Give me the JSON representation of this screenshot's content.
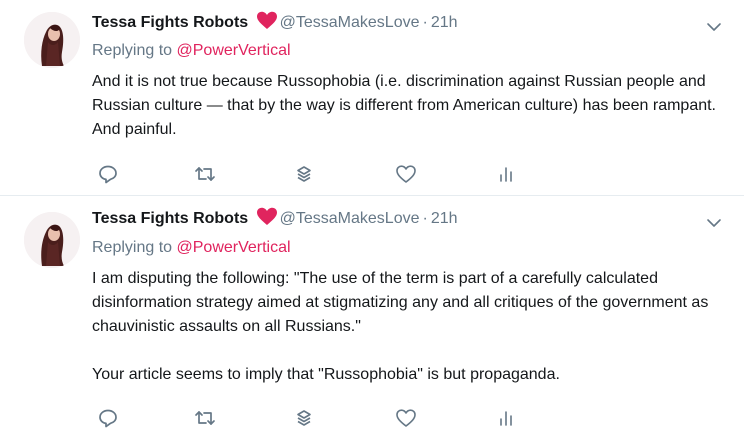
{
  "tweets": [
    {
      "author_name": "Tessa Fights Robots",
      "author_handle": "@TessaMakesLove",
      "separator": "·",
      "time": "21h",
      "reply_prefix": "Replying to ",
      "reply_mention": "@PowerVertical",
      "paragraphs": [
        "And it is not true because Russophobia (i.e. discrimination against Russian people and Russian culture — that by the way is different from American culture) has been rampant. And painful."
      ]
    },
    {
      "author_name": "Tessa Fights Robots",
      "author_handle": "@TessaMakesLove",
      "separator": "·",
      "time": "21h",
      "reply_prefix": "Replying to ",
      "reply_mention": "@PowerVertical",
      "paragraphs": [
        "I am disputing the following: \"The use of the term is part of a carefully calculated disinformation strategy aimed at stigmatizing any and all critiques of the government as chauvinistic assaults on all Russians.\"",
        "Your article seems to imply that \"Russophobia\" is but propaganda."
      ]
    }
  ],
  "icons": {
    "heart_emoji_color": "#e0245e",
    "action_icon_color": "#657786",
    "actions": [
      "reply-icon",
      "retweet-icon",
      "layers-icon",
      "like-icon",
      "analytics-icon"
    ]
  }
}
